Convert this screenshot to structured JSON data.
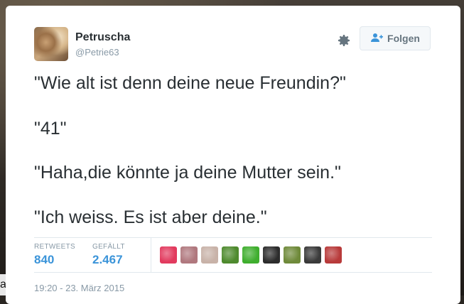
{
  "background": {
    "edge_text": "a"
  },
  "tweet": {
    "author": {
      "name": "Petruscha",
      "handle": "@Petrie63"
    },
    "follow_label": "Folgen",
    "lines": [
      "\"Wie alt ist denn deine neue Freundin?\"",
      "\"41\"",
      "\"Haha,die könnte ja deine Mutter sein.\"",
      "\"Ich weiss. Es ist aber deine.\""
    ],
    "stats": {
      "retweets_label": "RETWEETS",
      "retweets_value": "840",
      "likes_label": "GEFÄLLT",
      "likes_value": "2.467"
    },
    "favoriters": [
      {
        "color": "#e23a5e"
      },
      {
        "color": "#b0787e"
      },
      {
        "color": "#c8b2a8"
      },
      {
        "color": "#4e8a2e"
      },
      {
        "color": "#3fae2e"
      },
      {
        "color": "#2c2c2c"
      },
      {
        "color": "#6f8a3a"
      },
      {
        "color": "#3a3a3a"
      },
      {
        "color": "#b83a3a"
      }
    ],
    "timestamp": "19:20 - 23. März 2015"
  },
  "colors": {
    "link": "#3b94d9",
    "muted": "#8899a6",
    "text": "#292f33"
  }
}
